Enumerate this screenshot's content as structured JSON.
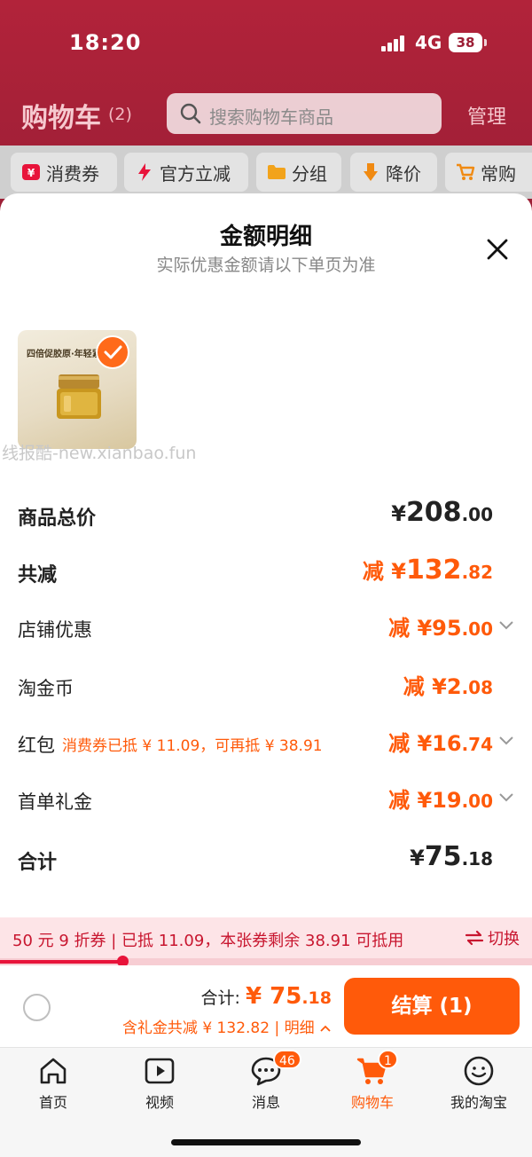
{
  "status": {
    "time": "18:20",
    "network": "4G",
    "battery": "38"
  },
  "header": {
    "title": "购物车",
    "count": "(2)",
    "search_placeholder": "搜索购物车商品",
    "manage": "管理"
  },
  "chips": [
    {
      "label": "消费券",
      "icon": "coupon-icon"
    },
    {
      "label": "官方立减",
      "icon": "lightning-icon"
    },
    {
      "label": "分组",
      "icon": "folder-icon"
    },
    {
      "label": "降价",
      "icon": "arrow-down-icon"
    },
    {
      "label": "常购",
      "icon": "cart-icon"
    }
  ],
  "sheet": {
    "title": "金额明细",
    "subtitle": "实际优惠金额请以下单页为准",
    "product": {
      "headline": "四倍促胶原·年轻紧",
      "selected": true
    },
    "watermark": "线报酷-new.xianbao.fun",
    "rows": {
      "subtotal": {
        "label": "商品总价",
        "prefix": "",
        "currency": "¥",
        "int": "208",
        "dec": ".00"
      },
      "total_discount": {
        "label": "共减",
        "prefix": "减 ",
        "currency": "¥",
        "int": "132",
        "dec": ".82"
      },
      "shop_discount": {
        "label": "店铺优惠",
        "prefix": "减 ",
        "currency": "¥",
        "int": "95",
        "dec": ".00"
      },
      "coins": {
        "label": "淘金币",
        "prefix": "减 ",
        "currency": "¥",
        "int": "2",
        "dec": ".08"
      },
      "red_packet": {
        "label": "红包",
        "note": "消费券已抵 ¥ 11.09，可再抵 ¥ 38.91",
        "prefix": "减 ",
        "currency": "¥",
        "int": "16",
        "dec": ".74"
      },
      "first_order": {
        "label": "首单礼金",
        "prefix": "减 ",
        "currency": "¥",
        "int": "19",
        "dec": ".00"
      },
      "total": {
        "label": "合计",
        "prefix": "",
        "currency": "¥",
        "int": "75",
        "dec": ".18"
      }
    }
  },
  "coupon_banner": {
    "text": "50 元 9 折券 | 已抵 11.09，本张券剩余 38.91 可抵用",
    "switch_label": "切换",
    "progress": 0.23
  },
  "settle": {
    "total_label": "合计: ",
    "total_currency": "¥",
    "total_int": "75",
    "total_dec": ".18",
    "discount_text": "含礼金共减 ¥ 132.82 | 明细",
    "pay_label": "结算 (1)"
  },
  "tabs": [
    {
      "label": "首页",
      "icon": "home-icon"
    },
    {
      "label": "视频",
      "icon": "video-icon"
    },
    {
      "label": "消息",
      "icon": "message-icon",
      "badge": "46"
    },
    {
      "label": "购物车",
      "icon": "cart-icon",
      "badge": "1",
      "active": true
    },
    {
      "label": "我的淘宝",
      "icon": "profile-icon"
    }
  ],
  "colors": {
    "brand": "#ff5a0a",
    "header": "#9c1f36",
    "banner_text": "#c8162f"
  }
}
